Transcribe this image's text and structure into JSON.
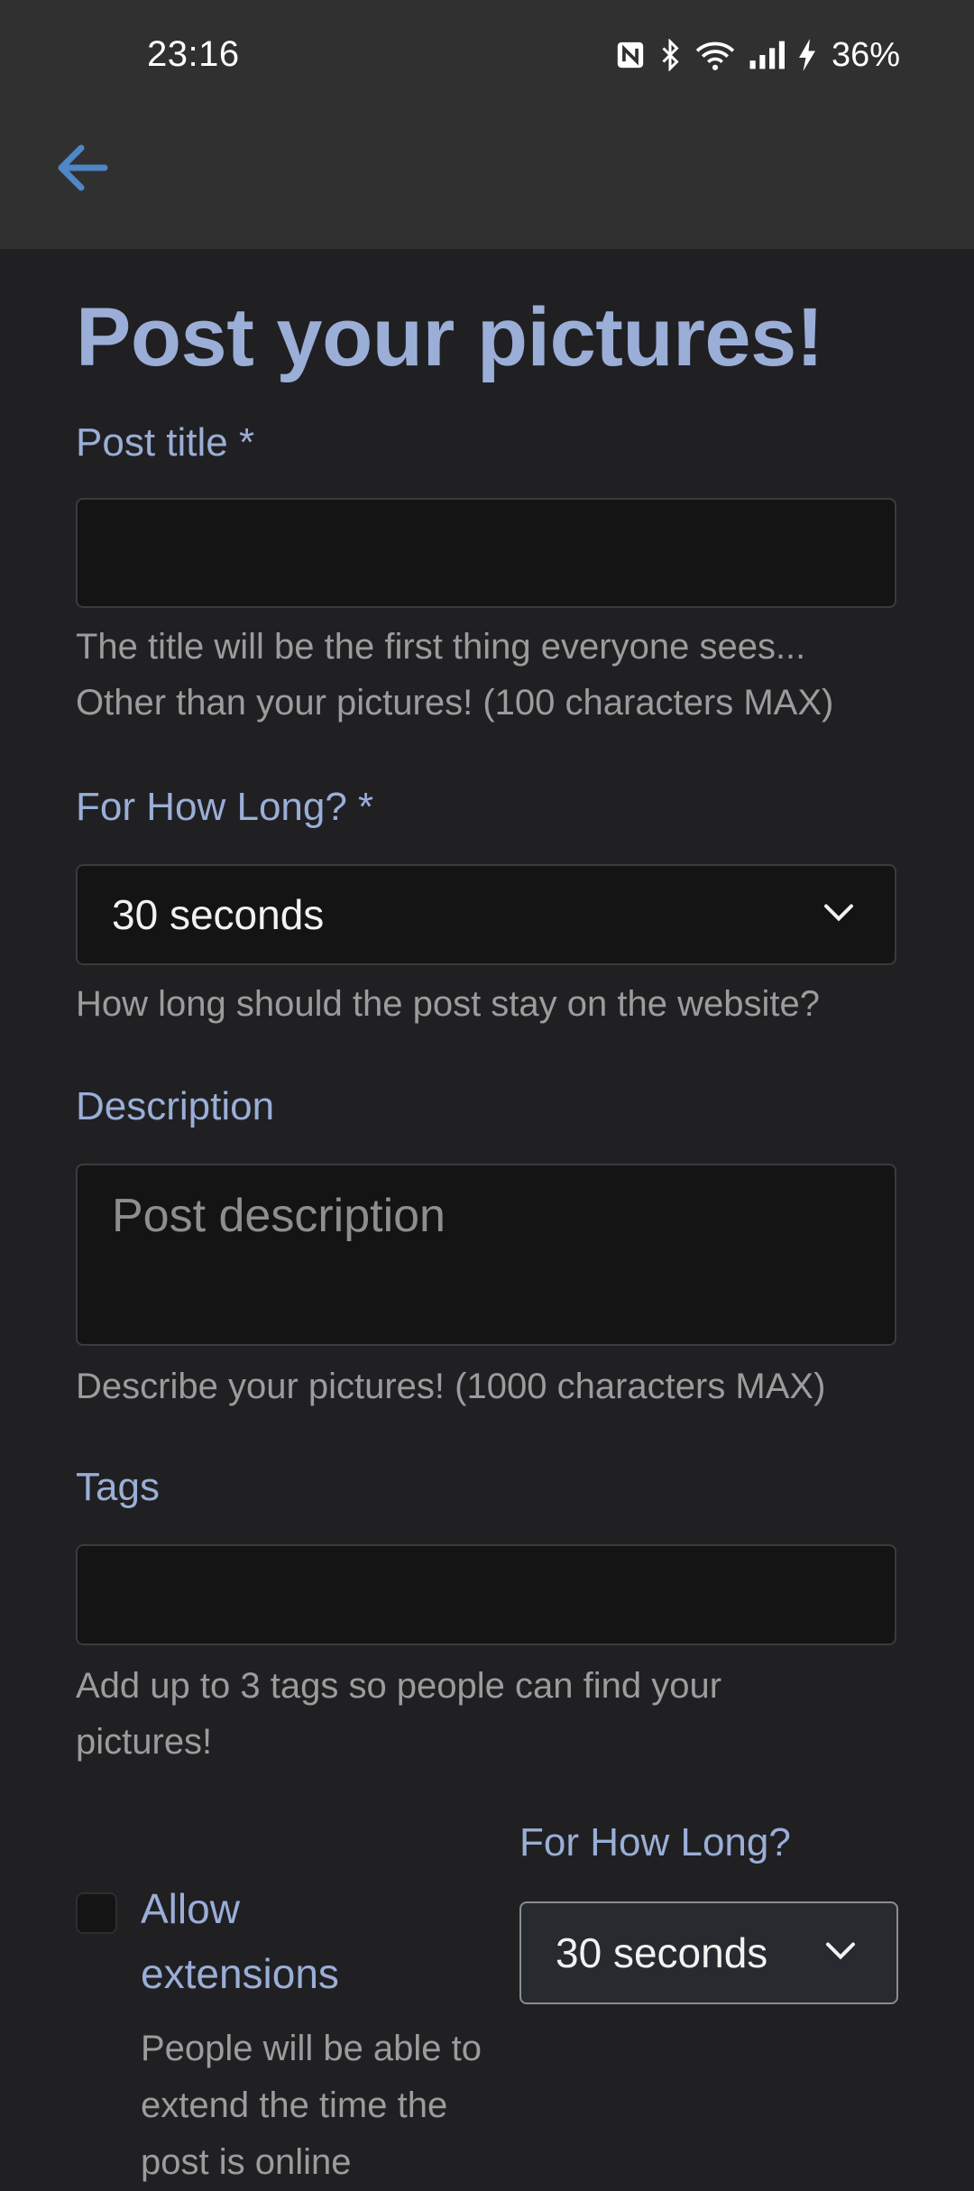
{
  "status_bar": {
    "time": "23:16",
    "battery": "36%",
    "icons": [
      "nfc-icon",
      "bluetooth-icon",
      "wifi-icon",
      "signal-icon",
      "charging-icon"
    ]
  },
  "nav": {
    "back_icon": "arrow-left-icon"
  },
  "page": {
    "title": "Post your pictures!"
  },
  "form": {
    "post_title": {
      "label": "Post title *",
      "value": "",
      "help": "The title will be the first thing everyone sees... Other than your pictures! (100 characters MAX)"
    },
    "duration": {
      "label": "For How Long? *",
      "selected": "30 seconds",
      "help": "How long should the post stay on the website?"
    },
    "description": {
      "label": "Description",
      "placeholder": "Post description",
      "help": "Describe your pictures! (1000 characters MAX)"
    },
    "tags": {
      "label": "Tags",
      "value": "",
      "help": "Add up to 3 tags so people can find your pictures!"
    },
    "extensions": {
      "label": "Allow extensions",
      "checked": false,
      "help": "People will be able to extend the time the post is online"
    },
    "extension_duration": {
      "label": "For How Long?",
      "selected": "30 seconds"
    }
  },
  "colors": {
    "accent": "#9aaed7",
    "back_arrow": "#4f86c6",
    "background": "#202023",
    "app_bar": "#303030",
    "field_bg": "#141414"
  }
}
